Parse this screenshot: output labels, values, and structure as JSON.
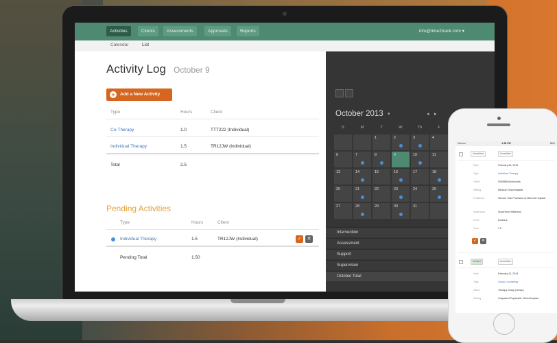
{
  "nav": {
    "tabs": [
      {
        "label": "Activities",
        "active": true
      },
      {
        "label": "Clients"
      },
      {
        "label": "Assessments"
      },
      {
        "label": "Approvals"
      },
      {
        "label": "Reports"
      }
    ],
    "user_email": "info@time2track.com"
  },
  "subnav": {
    "items": [
      {
        "label": "Calendar"
      },
      {
        "label": "List"
      }
    ]
  },
  "activity_log": {
    "title": "Activity Log",
    "date": "October 9",
    "add_button": "Add a New Activity",
    "columns": [
      "Type",
      "Hours",
      "Client"
    ],
    "rows": [
      {
        "type": "Co-Therapy",
        "hours": "1.0",
        "client": "TTT222 (Individual)"
      },
      {
        "type": "Individual Therapy",
        "hours": "1.5",
        "client": "TR12JW (Individual)"
      }
    ],
    "total_label": "Total",
    "total_value": "2.5"
  },
  "pending": {
    "title": "Pending Activities",
    "columns": [
      "Type",
      "Hours",
      "Client"
    ],
    "rows": [
      {
        "type": "Individual Therapy",
        "hours": "1.5",
        "client": "TR12JW (Individual)"
      }
    ],
    "total_label": "Pending Total",
    "total_value": "1.50"
  },
  "calendar": {
    "month": "October 2013",
    "days_of_week": [
      "S",
      "M",
      "T",
      "W",
      "Th",
      "F"
    ],
    "weeks": [
      [
        "",
        "",
        "1",
        "2",
        "3",
        "4"
      ],
      [
        "6",
        "7",
        "8",
        "9",
        "10",
        "11"
      ],
      [
        "13",
        "14",
        "15",
        "16",
        "17",
        "18"
      ],
      [
        "20",
        "21",
        "22",
        "23",
        "24",
        "25"
      ],
      [
        "27",
        "28",
        "29",
        "30",
        "31",
        ""
      ]
    ],
    "categories": [
      "Intervention",
      "Assessment",
      "Support",
      "Supervision",
      "October Total"
    ]
  },
  "phone": {
    "status": {
      "carrier": "Verizon",
      "time": "4:38 PM",
      "battery": "85%"
    },
    "card1": {
      "approved": "Unverified",
      "reviewed": "Unverified",
      "fields": [
        {
          "k": "Date",
          "v": "February 24, 2014"
        },
        {
          "k": "Type",
          "v": "Individual Therapy"
        },
        {
          "k": "Client",
          "v": "0000888 (Individual)"
        },
        {
          "k": "Setting",
          "v": "Medical Clinic/Hospital"
        },
        {
          "k": "Practicum",
          "v": "Second Year Practicum at McLeod Hospital"
        },
        {
          "k": "Supervisor",
          "v": "Supervisor Wilkerson"
        },
        {
          "k": "Level",
          "v": "Doctoral"
        },
        {
          "k": "Time",
          "v": "1.5"
        }
      ]
    },
    "card2": {
      "approved": "Verified",
      "reviewed": "Unverified",
      "fields": [
        {
          "k": "Date",
          "v": "February 21, 2014"
        },
        {
          "k": "Type",
          "v": "Group Counseling"
        },
        {
          "k": "Client",
          "v": "Therapy Group (Group)"
        },
        {
          "k": "Setting",
          "v": "Outpatient Psychiatric Clinic/Hospital"
        }
      ]
    }
  },
  "colors": {
    "brand": "#4e8a72",
    "accent": "#d5651f",
    "pending": "#e6a23a",
    "link": "#3e74b6"
  }
}
